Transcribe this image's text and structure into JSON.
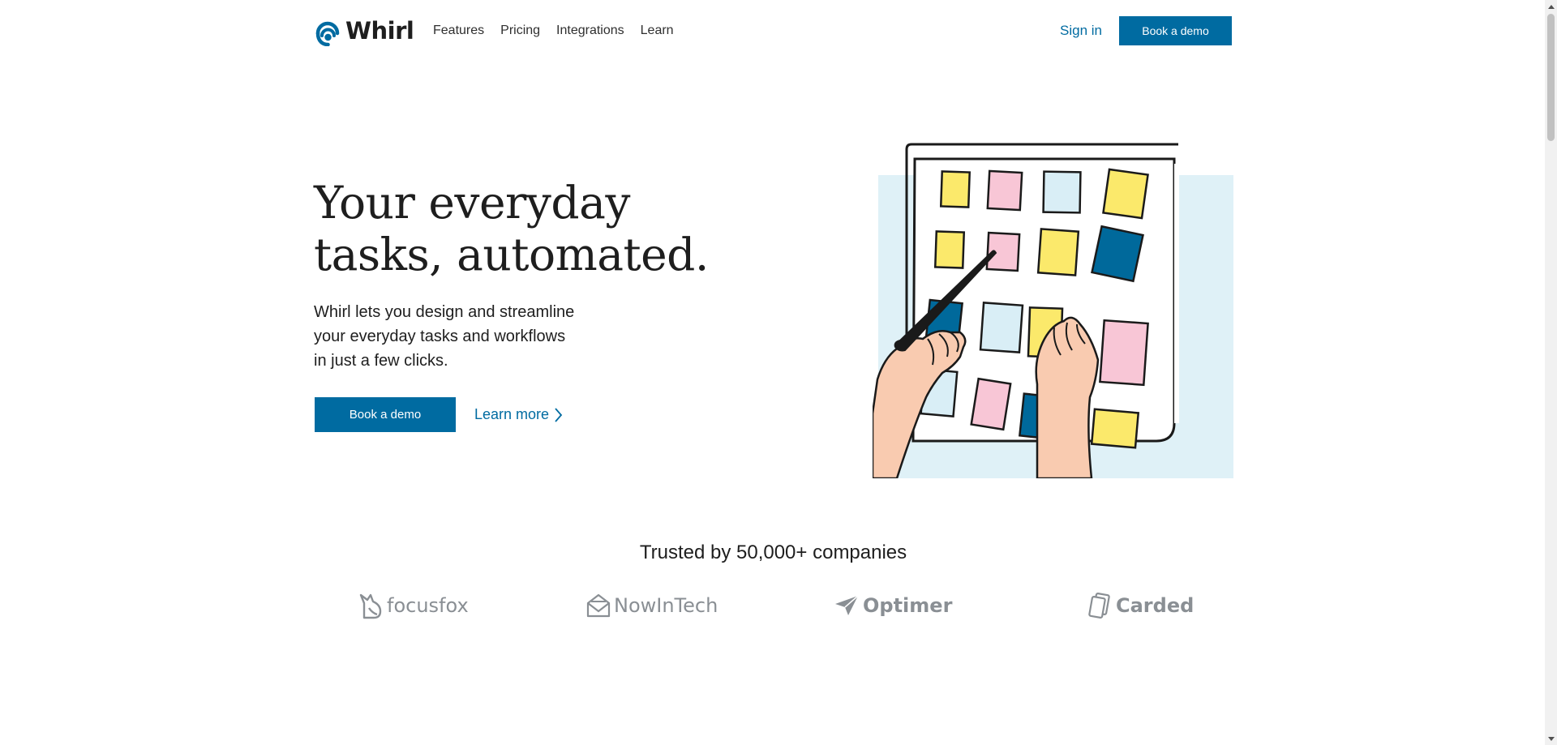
{
  "header": {
    "logo_text": "Whirl",
    "nav": [
      "Features",
      "Pricing",
      "Integrations",
      "Learn"
    ],
    "sign_in": "Sign in",
    "cta": "Book a demo"
  },
  "hero": {
    "title_lines": [
      "Your everyday",
      "tasks, automated."
    ],
    "description_lines": [
      "Whirl lets you design and streamline",
      "your everyday tasks and workflows",
      "in just a few clicks."
    ],
    "primary_cta": "Book a demo",
    "secondary_cta": "Learn more"
  },
  "trusted": {
    "heading": "Trusted by 50,000+ companies",
    "brands": [
      {
        "name": "focusfox",
        "icon": "fox-icon"
      },
      {
        "name": "NowInTech",
        "icon": "envelope-icon"
      },
      {
        "name": "Optimer",
        "icon": "paper-plane-icon"
      },
      {
        "name": "Carded",
        "icon": "cards-icon"
      }
    ]
  },
  "colors": {
    "accent": "#006ba1",
    "text": "#1e1e1e",
    "logo_gray": "#8a8f94",
    "illustration_bg": "#dff1f7",
    "note_yellow": "#fbe96b",
    "note_pink": "#f8c6d6",
    "note_lightblue": "#d9eef6",
    "note_blue": "#00699b",
    "skin": "#f9cbb0"
  }
}
